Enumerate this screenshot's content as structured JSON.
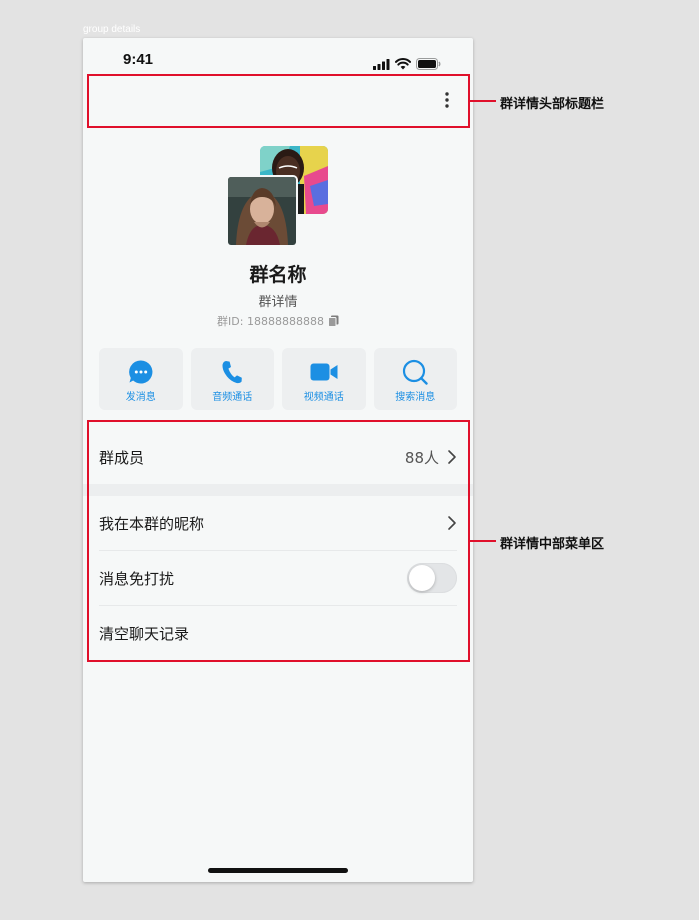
{
  "frame": {
    "label": "group details"
  },
  "status_bar": {
    "time": "9:41",
    "icons": [
      "cellular-signal-icon",
      "wifi-icon",
      "battery-icon"
    ]
  },
  "header": {
    "more_icon": "more-vertical-icon"
  },
  "group": {
    "name": "群名称",
    "description": "群详情",
    "id_text": "群ID: 18888888888",
    "copy_icon": "copy-icon"
  },
  "actions": [
    {
      "label": "发消息",
      "icon": "chat-bubble-icon"
    },
    {
      "label": "音频通话",
      "icon": "phone-icon"
    },
    {
      "label": "视频通话",
      "icon": "video-camera-icon"
    },
    {
      "label": "搜索消息",
      "icon": "search-icon"
    }
  ],
  "menu": {
    "members": {
      "label": "群成员",
      "value": "88人"
    },
    "nickname": {
      "label": "我在本群的昵称"
    },
    "mute": {
      "label": "消息免打扰",
      "enabled": false
    },
    "clear": {
      "label": "清空聊天记录"
    }
  },
  "annotations": {
    "header": "群详情头部标题栏",
    "menu": "群详情中部菜单区"
  },
  "colors": {
    "accent": "#1c8fe3",
    "annotation": "#e0102b",
    "background": "#f6f8f8"
  }
}
